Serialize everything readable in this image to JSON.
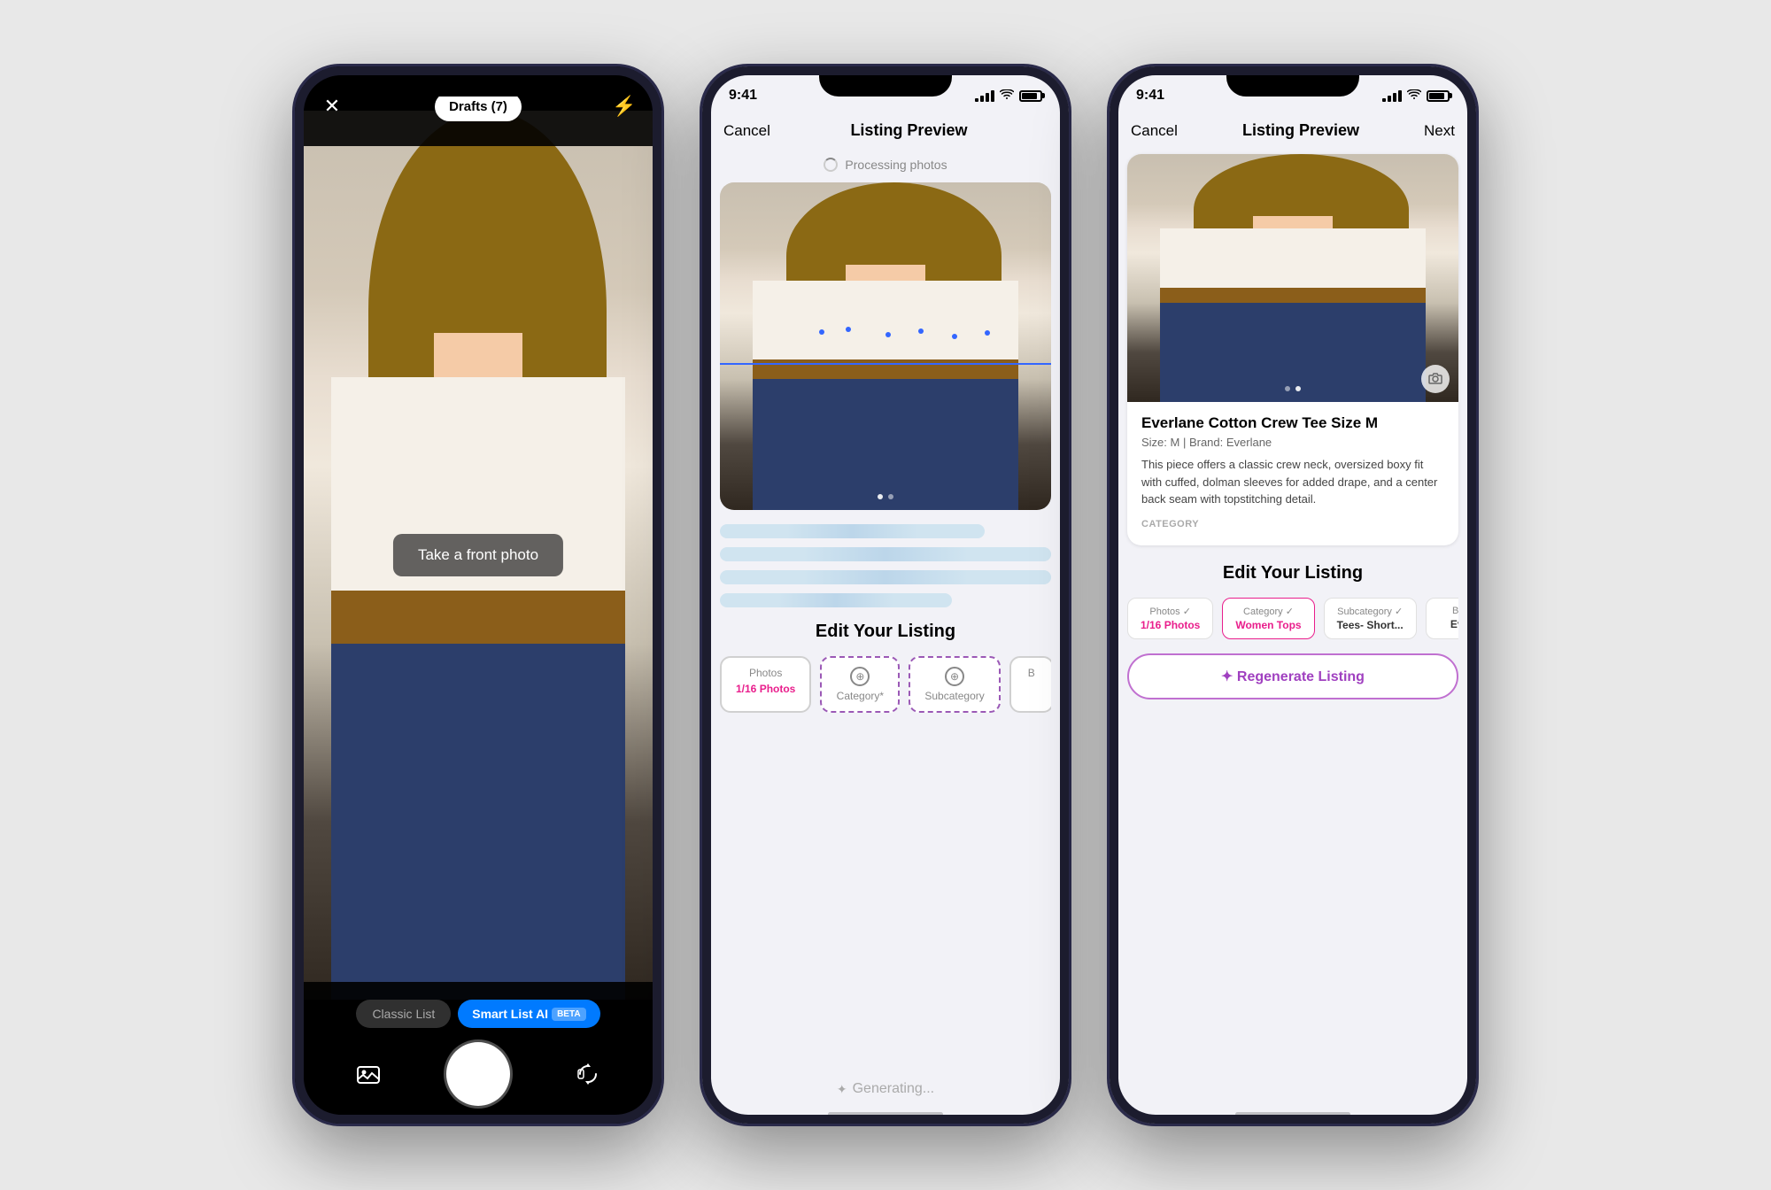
{
  "phone1": {
    "top_bar": {
      "close_label": "✕",
      "drafts_label": "Drafts (7)",
      "flash_label": "⚡"
    },
    "viewfinder": {
      "overlay_text": "Take a front photo"
    },
    "bottom_bar": {
      "classic_label": "Classic List",
      "smart_label": "Smart List AI",
      "beta_label": "BETA"
    }
  },
  "phone2": {
    "status_bar": {
      "time": "9:41"
    },
    "nav": {
      "cancel": "Cancel",
      "title": "Listing Preview",
      "next": ""
    },
    "processing": {
      "text": "Processing photos"
    },
    "image": {
      "dots": [
        "active",
        "inactive"
      ]
    },
    "skeleton_lines": [
      {
        "width": "80%"
      },
      {
        "width": "100%"
      },
      {
        "width": "100%"
      },
      {
        "width": "70%"
      }
    ],
    "edit_section": {
      "title": "Edit Your Listing",
      "tabs": [
        {
          "label_top": "Photos",
          "label_bottom": "1/16 Photos",
          "has_icon": false,
          "selected": false
        },
        {
          "label_top": "Category*",
          "label_bottom": "",
          "has_icon": true,
          "selected": true
        },
        {
          "label_top": "Subcategory",
          "label_bottom": "",
          "has_icon": true,
          "selected": true
        }
      ],
      "generating": "Generating..."
    }
  },
  "phone3": {
    "status_bar": {
      "time": "9:41"
    },
    "nav": {
      "cancel": "Cancel",
      "title": "Listing Preview",
      "next": "Next"
    },
    "listing": {
      "title": "Everlane Cotton Crew Tee Size M",
      "meta": "Size: M  |  Brand: Everlane",
      "description": "This piece offers a classic crew neck, oversized boxy fit with cuffed, dolman sleeves for added drape, and a center back seam with topstitching detail.",
      "category_label": "CATEGORY"
    },
    "image": {
      "dots": [
        "inactive",
        "active"
      ]
    },
    "edit_section": {
      "title": "Edit Your Listing",
      "tabs": [
        {
          "label_top": "Photos ✓",
          "label_bottom": "1/16 Photos"
        },
        {
          "label_top": "Category ✓",
          "label_bottom": "Women Tops"
        },
        {
          "label_top": "Subcategory ✓",
          "label_bottom": "Tees- Short..."
        },
        {
          "label_top": "Br...",
          "label_bottom": "Ev..."
        }
      ]
    },
    "regenerate_btn": "✦ Regenerate Listing"
  }
}
